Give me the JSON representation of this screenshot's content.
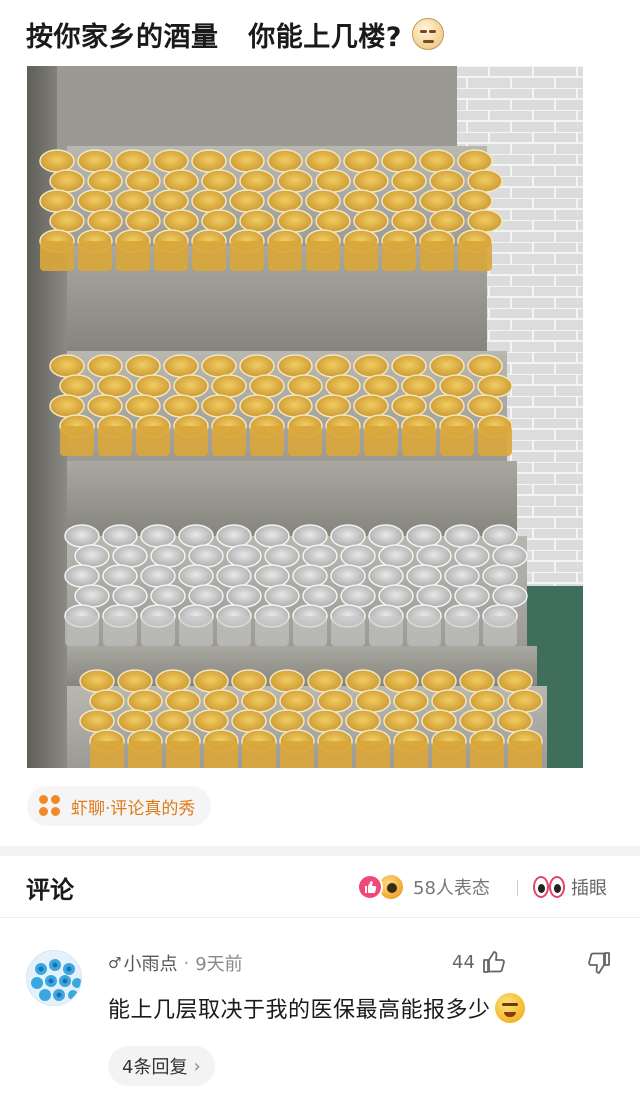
{
  "post": {
    "title": "按你家乡的酒量   你能上几楼?",
    "title_emoji": "smirk-face-icon"
  },
  "image": {
    "description_icon": "beer-cups-on-stairs-photo"
  },
  "topic": {
    "label": "虾聊·评论真的秀",
    "icon": "clover-icon",
    "color": "#e07b1a"
  },
  "comments_section": {
    "title": "评论",
    "reaction_count_label": "58人表态",
    "eyes_label": "插眼"
  },
  "comment": {
    "gender": "♂",
    "username": "小雨点",
    "time": "9天前",
    "likes": "44",
    "text": "能上几层取决于我的医保最高能报多少",
    "replies_label": "4条回复",
    "reply_chevron": "›"
  },
  "colors": {
    "accent_orange": "#f08a24",
    "like_pink": "#f0487a",
    "beer": "#e3b44a",
    "concrete": "#9b9a94"
  }
}
